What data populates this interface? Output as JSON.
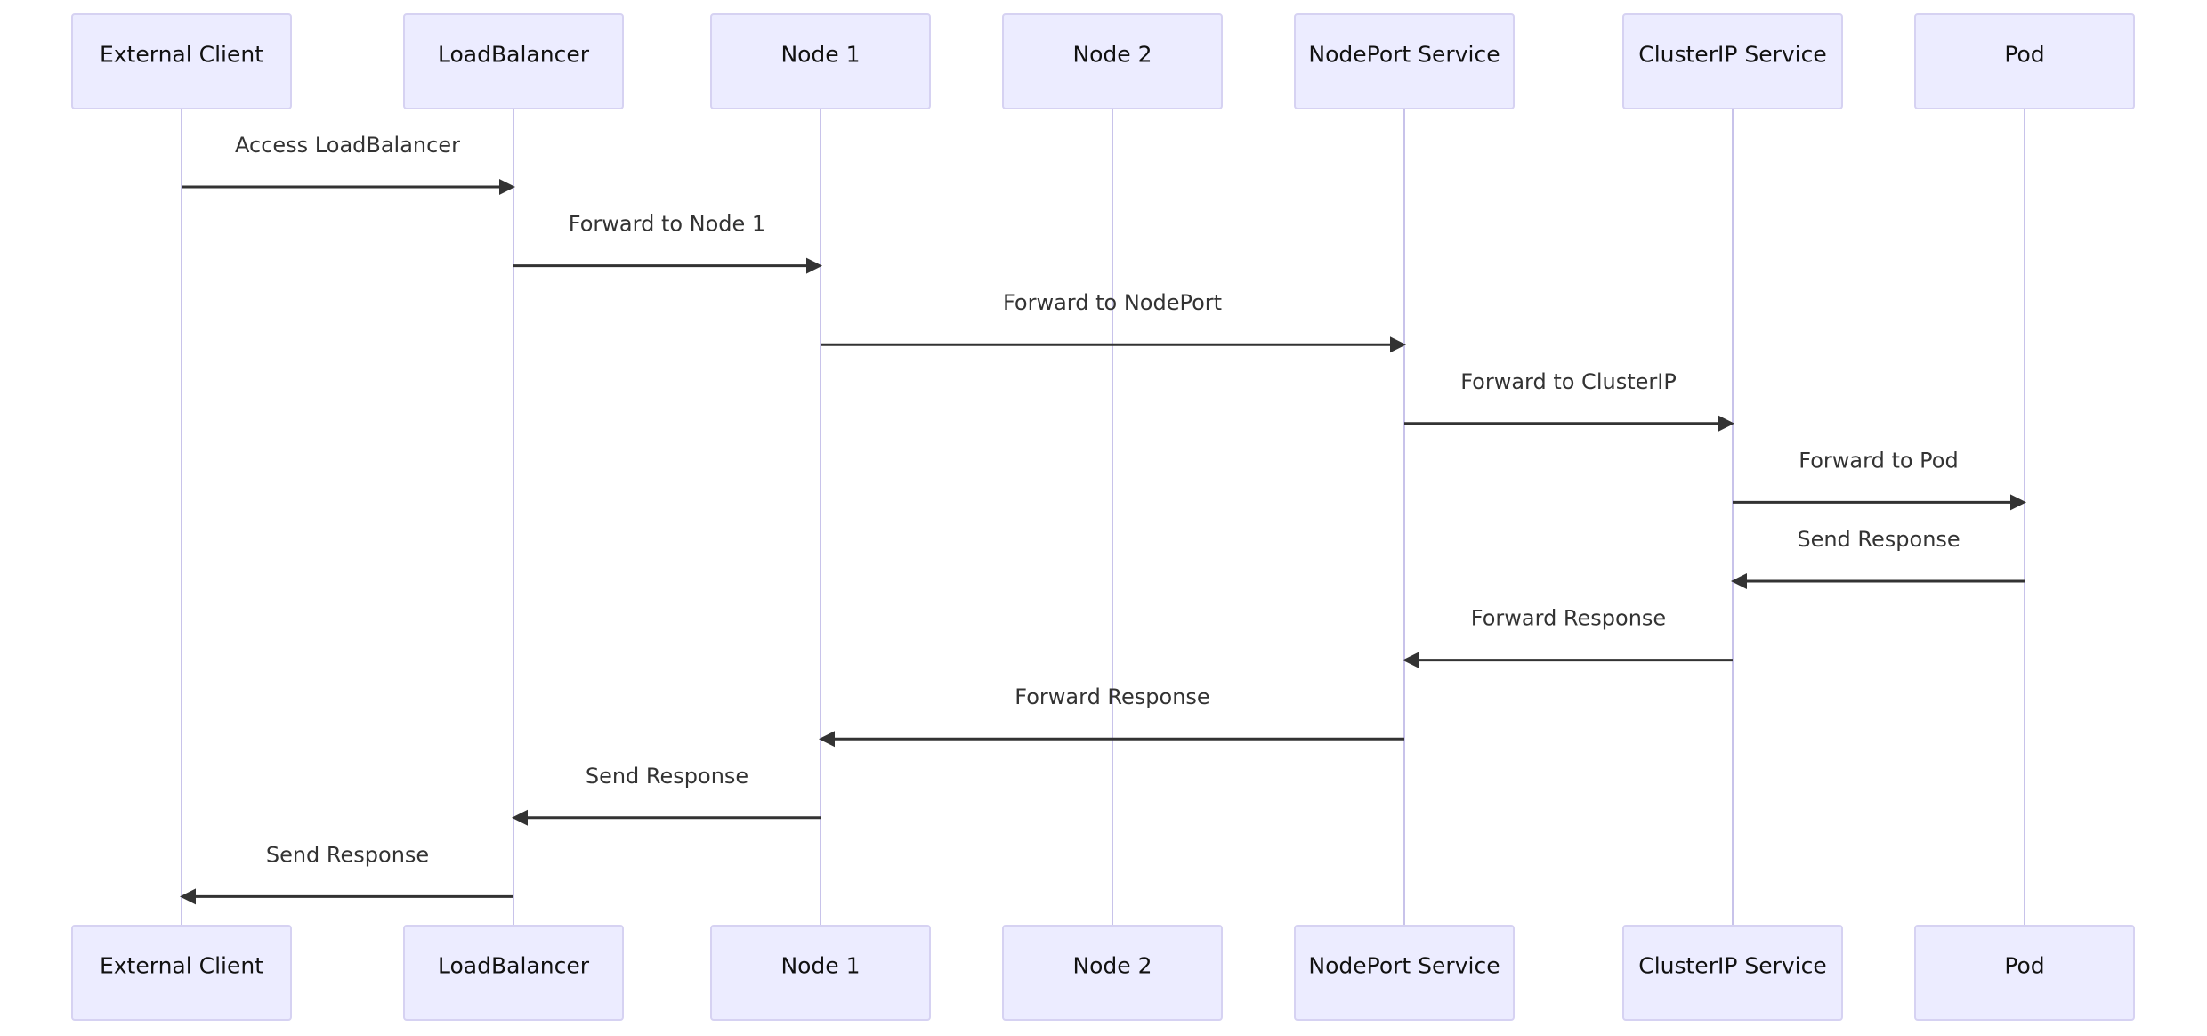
{
  "diagram": {
    "type": "sequence",
    "colors": {
      "actor_fill": "#ECECFF",
      "actor_stroke": "#d6d2f2",
      "lifeline": "#c8c3ea",
      "message": "#333333",
      "text": "#333333"
    },
    "participants": [
      {
        "id": "client",
        "label": "External Client"
      },
      {
        "id": "lb",
        "label": "LoadBalancer"
      },
      {
        "id": "node1",
        "label": "Node 1"
      },
      {
        "id": "node2",
        "label": "Node 2"
      },
      {
        "id": "nodeport",
        "label": "NodePort Service"
      },
      {
        "id": "clusterip",
        "label": "ClusterIP Service"
      },
      {
        "id": "pod",
        "label": "Pod"
      }
    ],
    "messages": [
      {
        "from": "client",
        "to": "lb",
        "label": "Access LoadBalancer"
      },
      {
        "from": "lb",
        "to": "node1",
        "label": "Forward to Node 1"
      },
      {
        "from": "node1",
        "to": "nodeport",
        "label": "Forward to NodePort"
      },
      {
        "from": "nodeport",
        "to": "clusterip",
        "label": "Forward to ClusterIP"
      },
      {
        "from": "clusterip",
        "to": "pod",
        "label": "Forward to Pod"
      },
      {
        "from": "pod",
        "to": "clusterip",
        "label": "Send Response"
      },
      {
        "from": "clusterip",
        "to": "nodeport",
        "label": "Forward Response"
      },
      {
        "from": "nodeport",
        "to": "node1",
        "label": "Forward Response"
      },
      {
        "from": "node1",
        "to": "lb",
        "label": "Send Response"
      },
      {
        "from": "lb",
        "to": "client",
        "label": "Send Response"
      }
    ]
  }
}
